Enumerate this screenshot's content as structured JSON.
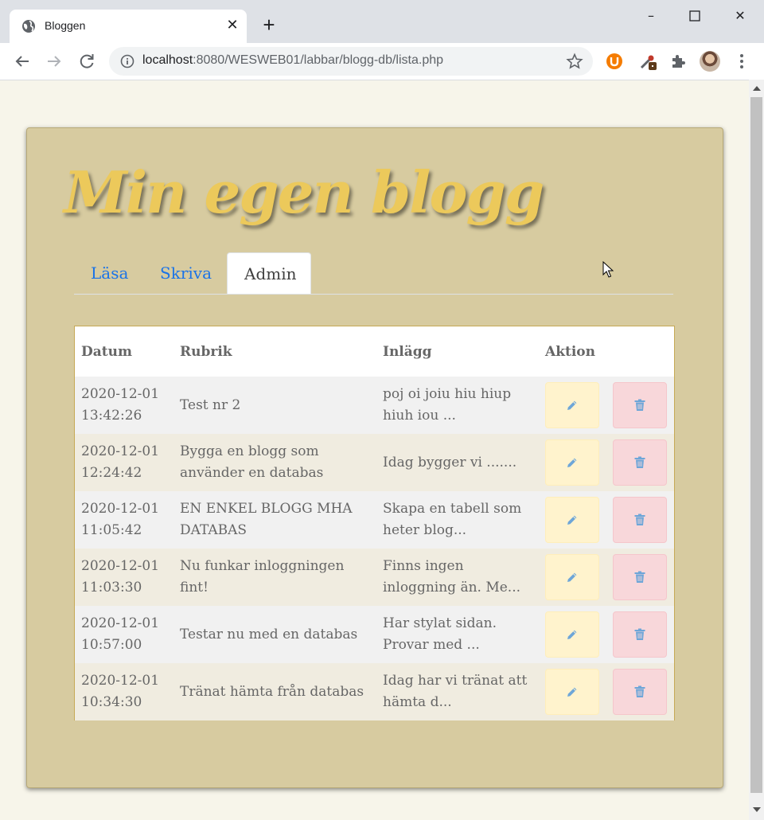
{
  "browser": {
    "tab_title": "Bloggen",
    "url_host": "localhost",
    "url_path": ":8080/WESWEB01/labbar/blogg-db/lista.php",
    "window_controls": [
      "minimize-icon",
      "maximize-icon",
      "close-icon"
    ],
    "extensions": [
      "ublock-icon",
      "eyedropper-icon",
      "puzzle-icon"
    ]
  },
  "page": {
    "logo": "Min egen blogg",
    "nav": [
      {
        "label": "Läsa",
        "active": false
      },
      {
        "label": "Skriva",
        "active": false
      },
      {
        "label": "Admin",
        "active": true
      }
    ],
    "table": {
      "headers": [
        "Datum",
        "Rubrik",
        "Inlägg",
        "Aktion"
      ],
      "rows": [
        {
          "date": "2020-12-01",
          "time": "13:42:26",
          "title": "Test nr 2",
          "excerpt": "poj oi joiu hiu hiup hiuh iou ..."
        },
        {
          "date": "2020-12-01",
          "time": "12:24:42",
          "title": "Bygga en blogg som använder en databas",
          "excerpt": "Idag bygger vi ......."
        },
        {
          "date": "2020-12-01",
          "time": "11:05:42",
          "title": "EN ENKEL BLOGG MHA DATABAS",
          "excerpt": "Skapa en tabell som heter blog..."
        },
        {
          "date": "2020-12-01",
          "time": "11:03:30",
          "title": "Nu funkar inloggningen fint!",
          "excerpt": "Finns ingen inloggning än. Me..."
        },
        {
          "date": "2020-12-01",
          "time": "10:57:00",
          "title": "Testar nu med en databas",
          "excerpt": "Har stylat sidan. Provar med ..."
        },
        {
          "date": "2020-12-01",
          "time": "10:34:30",
          "title": "Tränat hämta från databas",
          "excerpt": "Idag har vi tränat att hämta d..."
        }
      ],
      "actions": [
        "pencil-icon",
        "trash-icon"
      ]
    }
  },
  "colors": {
    "page_bg": "#f7f5ea",
    "container_bg": "#d7cba0",
    "logo": "#ecc95b",
    "link": "#1a73e8",
    "edit_btn": "#fff3cd",
    "delete_btn": "#f8d7da",
    "icon": "#6ea6d8"
  }
}
